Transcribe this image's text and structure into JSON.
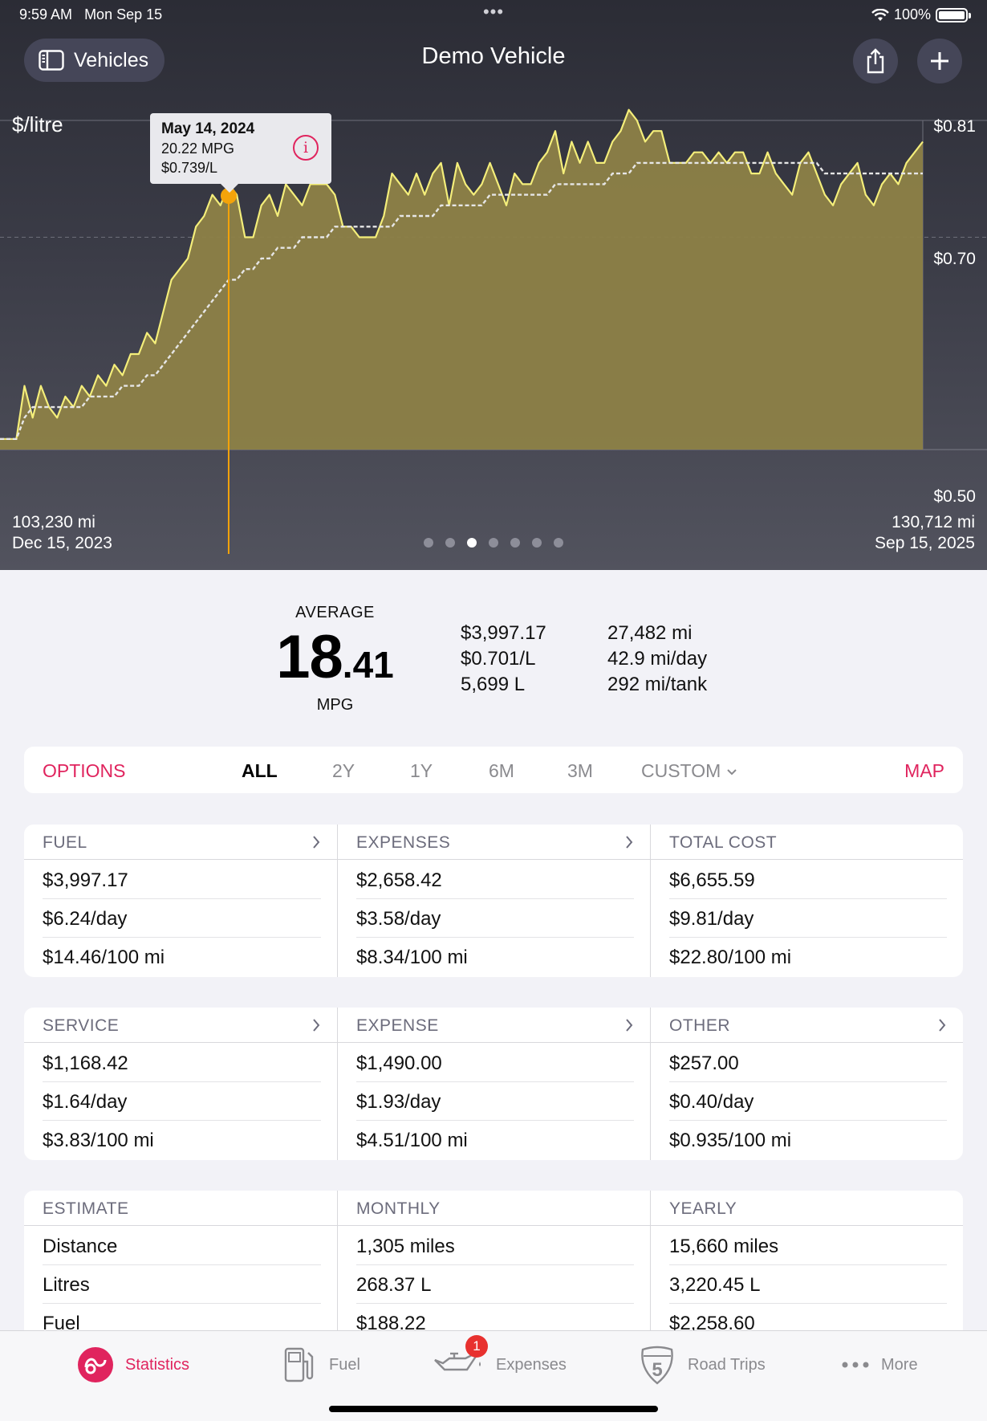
{
  "status_bar": {
    "time": "9:59 AM",
    "date": "Mon Sep 15",
    "battery": "100%",
    "dots": "•••"
  },
  "nav": {
    "vehicles_label": "Vehicles",
    "title": "Demo Vehicle",
    "share_icon": "share-icon",
    "add_icon": "plus-icon"
  },
  "colors": {
    "accent": "#e0245e",
    "line": "#f4ee7a",
    "fill": "#8d8147",
    "marker": "#f4a30a",
    "header_bg": "#2b2c35"
  },
  "chart": {
    "unit_label": "$/litre",
    "start_odometer": "103,230 mi",
    "start_date": "Dec 15, 2023",
    "end_odometer": "130,712 mi",
    "end_date": "Sep 15, 2025",
    "y_tick_top": "$0.81",
    "y_tick_mid": "$0.70",
    "y_tick_bottom": "$0.50",
    "page_count": 7,
    "active_page": 3,
    "tooltip": {
      "date": "May 14, 2024",
      "mpg": "20.22 MPG",
      "price": "$0.739/L"
    }
  },
  "chart_data": {
    "type": "area",
    "y_unit": "$/litre",
    "ylim": [
      0.5,
      0.81
    ],
    "x_range": [
      "Dec 15, 2023",
      "Sep 15, 2025"
    ],
    "series": [
      {
        "values": [
          0.51,
          0.51,
          0.51,
          0.56,
          0.53,
          0.56,
          0.54,
          0.53,
          0.55,
          0.54,
          0.56,
          0.55,
          0.57,
          0.56,
          0.58,
          0.57,
          0.59,
          0.59,
          0.61,
          0.6,
          0.63,
          0.66,
          0.67,
          0.68,
          0.71,
          0.72,
          0.74,
          0.73,
          0.75,
          0.74,
          0.7,
          0.7,
          0.73,
          0.74,
          0.72,
          0.75,
          0.74,
          0.73,
          0.75,
          0.75,
          0.75,
          0.74,
          0.71,
          0.71,
          0.7,
          0.7,
          0.7,
          0.72,
          0.76,
          0.75,
          0.74,
          0.76,
          0.74,
          0.76,
          0.77,
          0.73,
          0.77,
          0.75,
          0.74,
          0.75,
          0.77,
          0.75,
          0.73,
          0.76,
          0.75,
          0.75,
          0.77,
          0.78,
          0.8,
          0.76,
          0.79,
          0.77,
          0.79,
          0.77,
          0.77,
          0.79,
          0.8,
          0.82,
          0.81,
          0.79,
          0.8,
          0.8,
          0.77,
          0.77,
          0.77,
          0.78,
          0.78,
          0.77,
          0.78,
          0.77,
          0.78,
          0.78,
          0.76,
          0.76,
          0.78,
          0.76,
          0.75,
          0.74,
          0.77,
          0.78,
          0.76,
          0.74,
          0.73,
          0.75,
          0.76,
          0.77,
          0.74,
          0.73,
          0.75,
          0.76,
          0.75,
          0.77,
          0.78,
          0.79
        ]
      },
      {
        "values": [
          0.51,
          0.51,
          0.51,
          0.53,
          0.54,
          0.54,
          0.54,
          0.54,
          0.54,
          0.54,
          0.54,
          0.55,
          0.55,
          0.55,
          0.55,
          0.56,
          0.56,
          0.56,
          0.57,
          0.57,
          0.58,
          0.59,
          0.6,
          0.61,
          0.62,
          0.63,
          0.64,
          0.65,
          0.66,
          0.66,
          0.67,
          0.67,
          0.68,
          0.68,
          0.69,
          0.69,
          0.69,
          0.7,
          0.7,
          0.7,
          0.7,
          0.71,
          0.71,
          0.71,
          0.71,
          0.71,
          0.71,
          0.71,
          0.71,
          0.72,
          0.72,
          0.72,
          0.72,
          0.72,
          0.73,
          0.73,
          0.73,
          0.73,
          0.73,
          0.73,
          0.74,
          0.74,
          0.74,
          0.74,
          0.74,
          0.74,
          0.74,
          0.74,
          0.75,
          0.75,
          0.75,
          0.75,
          0.75,
          0.75,
          0.75,
          0.76,
          0.76,
          0.76,
          0.77,
          0.77,
          0.77,
          0.77,
          0.77,
          0.77,
          0.77,
          0.77,
          0.77,
          0.77,
          0.77,
          0.77,
          0.77,
          0.77,
          0.77,
          0.77,
          0.77,
          0.77,
          0.77,
          0.77,
          0.77,
          0.77,
          0.77,
          0.76,
          0.76,
          0.76,
          0.76,
          0.76,
          0.76,
          0.76,
          0.76,
          0.76,
          0.76,
          0.76,
          0.76,
          0.76
        ]
      }
    ],
    "marker": {
      "index": 28,
      "value": 0.739,
      "label": "May 14, 2024"
    }
  },
  "summary": {
    "average_label": "AVERAGE",
    "average_int": "18",
    "average_dec": ".41",
    "average_unit": "MPG",
    "col1": [
      "$3,997.17",
      "$0.701/L",
      "5,699 L"
    ],
    "col2": [
      "27,482 mi",
      "42.9 mi/day",
      "292 mi/tank"
    ]
  },
  "range_bar": {
    "options": "OPTIONS",
    "ranges": [
      "ALL",
      "2Y",
      "1Y",
      "6M",
      "3M"
    ],
    "custom": "CUSTOM",
    "map": "MAP"
  },
  "cards": {
    "fuel": {
      "title": "FUEL",
      "rows": [
        "$3,997.17",
        "$6.24/day",
        "$14.46/100 mi"
      ]
    },
    "expenses": {
      "title": "EXPENSES",
      "rows": [
        "$2,658.42",
        "$3.58/day",
        "$8.34/100 mi"
      ]
    },
    "total": {
      "title": "TOTAL COST",
      "rows": [
        "$6,655.59",
        "$9.81/day",
        "$22.80/100 mi"
      ]
    },
    "service": {
      "title": "SERVICE",
      "rows": [
        "$1,168.42",
        "$1.64/day",
        "$3.83/100 mi"
      ]
    },
    "expense": {
      "title": "EXPENSE",
      "rows": [
        "$1,490.00",
        "$1.93/day",
        "$4.51/100 mi"
      ]
    },
    "other": {
      "title": "OTHER",
      "rows": [
        "$257.00",
        "$0.40/day",
        "$0.935/100 mi"
      ]
    },
    "estimate": {
      "title": "ESTIMATE",
      "rows": [
        "Distance",
        "Litres",
        "Fuel"
      ]
    },
    "monthly": {
      "title": "MONTHLY",
      "rows": [
        "1,305 miles",
        "268.37 L",
        "$188.22"
      ]
    },
    "yearly": {
      "title": "YEARLY",
      "rows": [
        "15,660 miles",
        "3,220.45 L",
        "$2,258.60"
      ]
    }
  },
  "tabbar": {
    "statistics": "Statistics",
    "fuel": "Fuel",
    "expenses": "Expenses",
    "expenses_badge": "1",
    "road_trips": "Road Trips",
    "road_trips_shield": "5",
    "more": "More"
  }
}
